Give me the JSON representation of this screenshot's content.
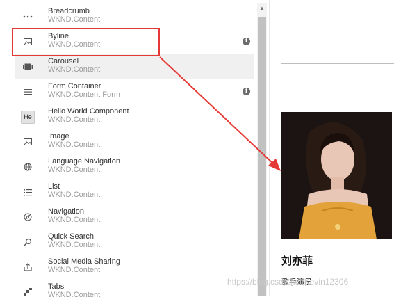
{
  "components": [
    {
      "title": "Breadcrumb",
      "group": "WKND.Content",
      "icon": "breadcrumb-dots-icon",
      "info": false
    },
    {
      "title": "Byline",
      "group": "WKND.Content",
      "icon": "image-icon",
      "info": true
    },
    {
      "title": "Carousel",
      "group": "WKND.Content",
      "icon": "carousel-icon",
      "info": false
    },
    {
      "title": "Form Container",
      "group": "WKND.Content Form",
      "icon": "form-lines-icon",
      "info": true
    },
    {
      "title": "Hello World Component",
      "group": "WKND.Content",
      "icon": "he-badge-icon",
      "badge": "He",
      "info": false
    },
    {
      "title": "Image",
      "group": "WKND.Content",
      "icon": "image-icon",
      "info": false
    },
    {
      "title": "Language Navigation",
      "group": "WKND.Content",
      "icon": "globe-icon",
      "info": false
    },
    {
      "title": "List",
      "group": "WKND.Content",
      "icon": "list-icon",
      "info": false
    },
    {
      "title": "Navigation",
      "group": "WKND.Content",
      "icon": "compass-icon",
      "info": false
    },
    {
      "title": "Quick Search",
      "group": "WKND.Content",
      "icon": "search-icon",
      "info": false
    },
    {
      "title": "Social Media Sharing",
      "group": "WKND.Content",
      "icon": "share-icon",
      "info": false
    },
    {
      "title": "Tabs",
      "group": "WKND.Content",
      "icon": "tabs-icon",
      "info": false
    }
  ],
  "info_glyph": "i",
  "preview": {
    "name": "刘亦菲",
    "role": "歌手演员"
  },
  "watermark": "https://blog.csdn.net/Kevin12306",
  "colors": {
    "annotation": "#e53935",
    "hover": "#f0f0f0"
  }
}
